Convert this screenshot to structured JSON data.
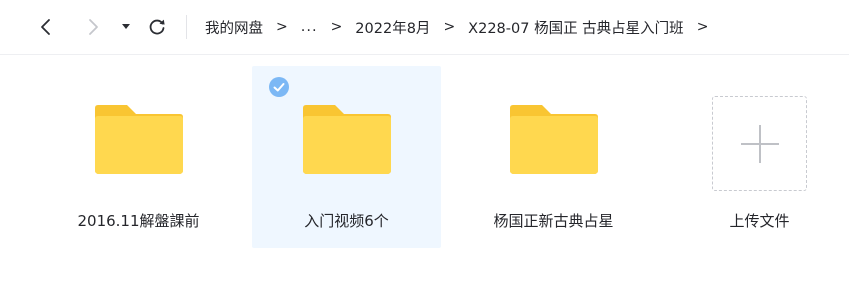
{
  "nav": {
    "back_icon": "chevron-left-icon",
    "forward_icon": "chevron-right-icon",
    "dropdown_icon": "caret-down-icon",
    "refresh_icon": "refresh-icon"
  },
  "breadcrumb": {
    "items": [
      "我的网盘",
      "...",
      "2022年8月",
      "X228-07 杨国正 古典占星入门班"
    ],
    "separator": ">"
  },
  "folders": [
    {
      "name": "2016.11解盤課前",
      "selected": false
    },
    {
      "name": "入门视频6个",
      "selected": true
    },
    {
      "name": "杨国正新古典占星",
      "selected": false
    }
  ],
  "upload": {
    "label": "上传文件",
    "icon": "plus-icon"
  },
  "colors": {
    "folder_back": "#F9C532",
    "folder_front": "#FFD84F",
    "selected_bg": "#EFF7FF",
    "check_badge": "#7CB8F5"
  }
}
